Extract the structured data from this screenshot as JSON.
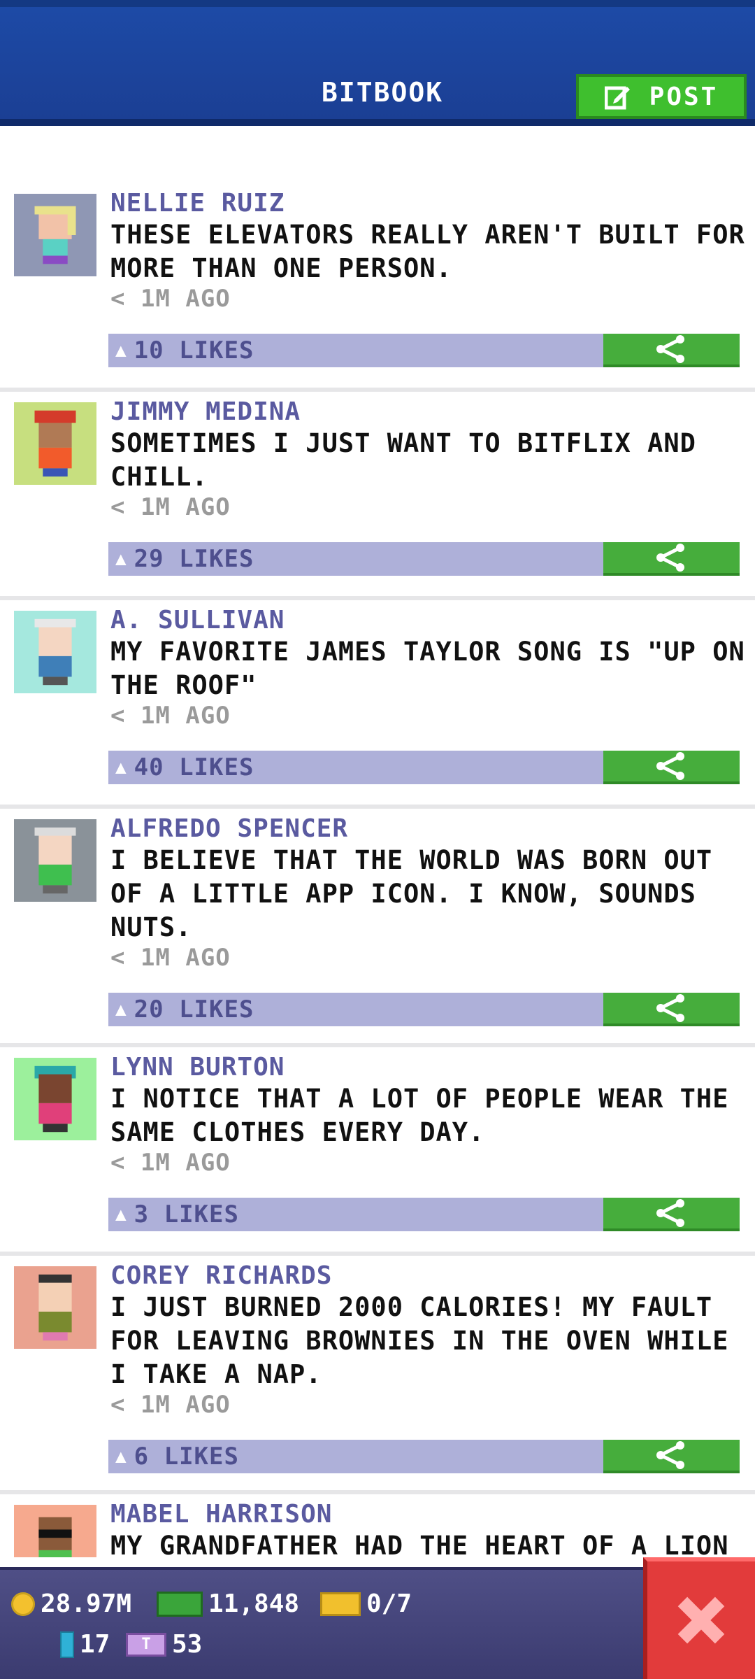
{
  "header": {
    "title": "BITBOOK",
    "post_button": "POST"
  },
  "posts": [
    {
      "name": "NELLIE RUIZ",
      "text": "THESE ELEVATORS REALLY AREN'T BUILT FOR MORE THAN ONE PERSON.",
      "time": "< 1M AGO",
      "likes": "10 LIKES",
      "avatar_bg": "#8f97b4"
    },
    {
      "name": "JIMMY MEDINA",
      "text": "SOMETIMES I JUST WANT TO BITFLIX AND CHILL.",
      "time": "< 1M AGO",
      "likes": "29 LIKES",
      "avatar_bg": "#c7df7f"
    },
    {
      "name": "A. SULLIVAN",
      "text": "MY FAVORITE JAMES TAYLOR SONG IS \"UP ON THE ROOF\"",
      "time": "< 1M AGO",
      "likes": "40 LIKES",
      "avatar_bg": "#a5e8de"
    },
    {
      "name": "ALFREDO SPENCER",
      "text": "I BELIEVE THAT THE WORLD WAS BORN OUT OF A LITTLE APP ICON. I KNOW, SOUNDS NUTS.",
      "time": "< 1M AGO",
      "likes": "20 LIKES",
      "avatar_bg": "#8a9299"
    },
    {
      "name": "LYNN BURTON",
      "text": "I NOTICE THAT A LOT OF PEOPLE WEAR THE SAME CLOTHES EVERY DAY.",
      "time": "< 1M AGO",
      "likes": "3 LIKES",
      "avatar_bg": "#9cf09c"
    },
    {
      "name": "COREY RICHARDS",
      "text": "I JUST BURNED 2000 CALORIES! MY FAULT FOR LEAVING BROWNIES IN THE OVEN WHILE I TAKE A NAP.",
      "time": "< 1M AGO",
      "likes": "6 LIKES",
      "avatar_bg": "#eaa28f"
    },
    {
      "name": "MABEL HARRISON",
      "text": "MY GRANDFATHER HAD THE HEART OF A LION AND A LIFETIME BAN FROM THE NEW YO",
      "time": "",
      "likes": "",
      "avatar_bg": "#f6a98e"
    }
  ],
  "status": {
    "coins": "28.97M",
    "cash": "11,848",
    "tickets": "0/7",
    "battery": "17",
    "tbucks": "53"
  },
  "colors": {
    "header": "#1d4aa6",
    "post_green": "#3fbf2e",
    "like_bar": "#aeb0d9",
    "share_green": "#46ad3c",
    "close_red": "#e23b3b"
  }
}
